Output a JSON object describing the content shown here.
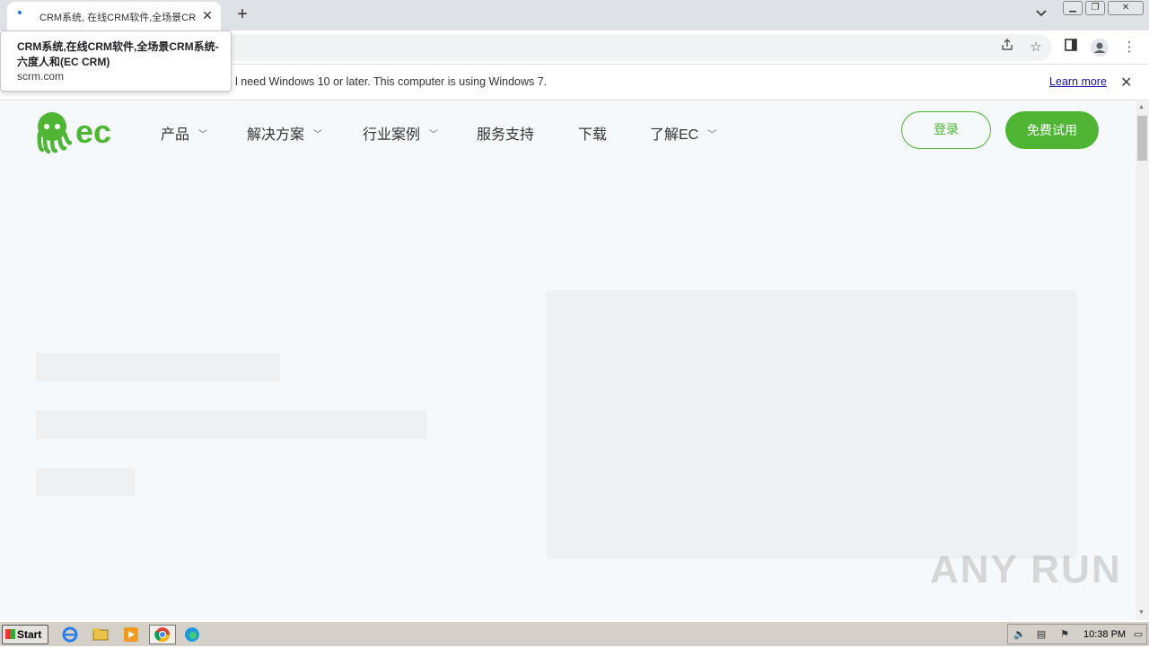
{
  "browser": {
    "tab_title": "CRM系统, 在线CRM软件,全场景CRM",
    "tooltip_title": "CRM系统,在线CRM软件,全场景CRM系统-六度人和(EC CRM)",
    "tooltip_domain": "scrm.com",
    "new_tab_label": "+",
    "tab_close_label": "✕",
    "infobar_message": "l need Windows 10 or later. This computer is using Windows 7.",
    "infobar_link": "Learn more",
    "infobar_close": "✕"
  },
  "site": {
    "logo_text": "ec",
    "nav": [
      {
        "label": "产品",
        "has_dropdown": true
      },
      {
        "label": "解决方案",
        "has_dropdown": true
      },
      {
        "label": "行业案例",
        "has_dropdown": true
      },
      {
        "label": "服务支持",
        "has_dropdown": false
      },
      {
        "label": "下载",
        "has_dropdown": false
      },
      {
        "label": "了解EC",
        "has_dropdown": true
      }
    ],
    "login_label": "登录",
    "trial_label": "免费试用",
    "brand_color": "#4fb535"
  },
  "watermark": "ANY RUN",
  "taskbar": {
    "start_label": "Start",
    "clock": "10:38 PM",
    "apps": [
      "ie-icon",
      "explorer-icon",
      "media-player-icon",
      "chrome-icon",
      "edge-icon"
    ]
  }
}
